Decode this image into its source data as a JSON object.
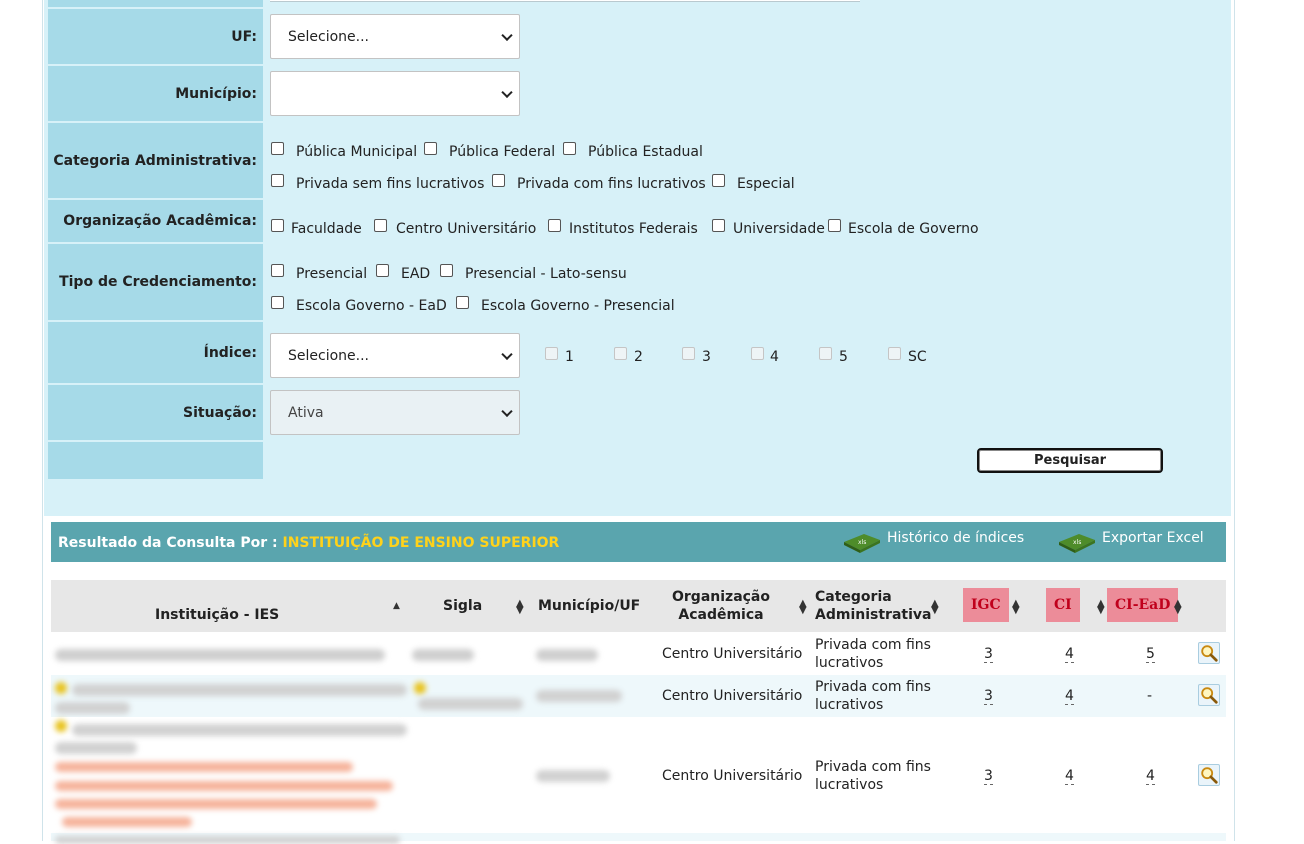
{
  "form": {
    "uf": {
      "label": "UF:",
      "value": "Selecione..."
    },
    "municipio": {
      "label": "Município:",
      "value": ""
    },
    "categoria": {
      "label": "Categoria Administrativa:",
      "options": [
        "Pública Municipal",
        "Pública Federal",
        "Pública Estadual",
        "Privada sem fins lucrativos",
        "Privada com fins lucrativos",
        "Especial"
      ]
    },
    "organizacao": {
      "label": "Organização Acadêmica:",
      "options": [
        "Faculdade",
        "Centro Universitário",
        "Institutos Federais",
        "Universidade",
        "Escola de Governo"
      ]
    },
    "credenciamento": {
      "label": "Tipo de Credenciamento:",
      "options": [
        "Presencial",
        "EAD",
        "Presencial - Lato-sensu",
        "Escola Governo - EaD",
        "Escola Governo - Presencial"
      ]
    },
    "indice": {
      "label": "Índice:",
      "value": "Selecione...",
      "options": [
        "1",
        "2",
        "3",
        "4",
        "5",
        "SC"
      ]
    },
    "situacao": {
      "label": "Situação:",
      "value": "Ativa"
    },
    "search_button": "Pesquisar"
  },
  "results": {
    "title_prefix": "Resultado da Consulta Por :",
    "title_highlight": "INSTITUIÇÃO DE ENSINO SUPERIOR",
    "historico_link": "Histórico de índices",
    "exportar_link": "Exportar Excel",
    "columns": {
      "instituicao": "Instituição - IES",
      "sigla": "Sigla",
      "municipio": "Município/UF",
      "organizacao_1": "Organização",
      "organizacao_2": "Acadêmica",
      "categoria_1": "Categoria",
      "categoria_2": "Administrativa",
      "igc": "IGC",
      "ci": "CI",
      "ciead": "CI-EaD"
    },
    "rows": [
      {
        "organizacao": "Centro Universitário",
        "categoria_1": "Privada com fins",
        "categoria_2": "lucrativos",
        "igc": "3",
        "ci": "4",
        "ciead": "5"
      },
      {
        "organizacao": "Centro Universitário",
        "categoria_1": "Privada com fins",
        "categoria_2": "lucrativos",
        "igc": "3",
        "ci": "4",
        "ciead": "-"
      },
      {
        "organizacao": "Centro Universitário",
        "categoria_1": "Privada com fins",
        "categoria_2": "lucrativos",
        "igc": "3",
        "ci": "4",
        "ciead": "4"
      }
    ]
  },
  "colors": {
    "form_bg": "#d7f1f8",
    "label_bg": "#a6dae8",
    "result_bar": "#5aa5ae",
    "highlight": "#ffd21a",
    "score_header_bg": "#ec8c99",
    "score_header_text": "#c0001c"
  }
}
